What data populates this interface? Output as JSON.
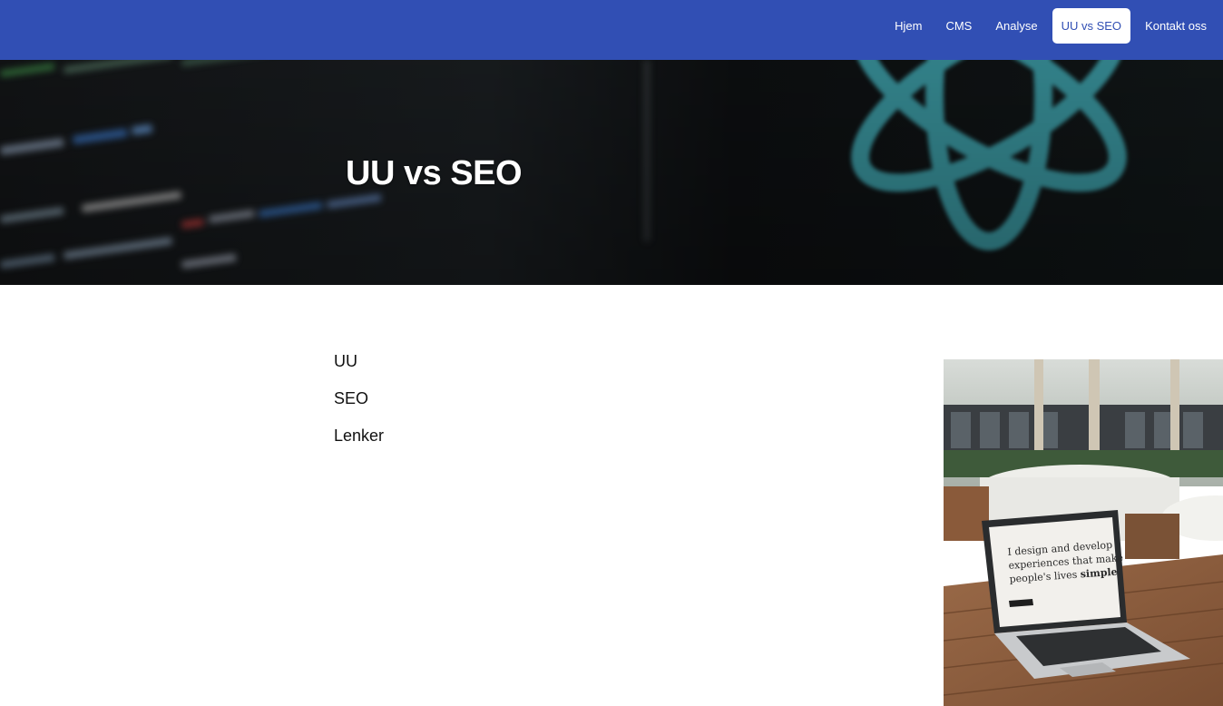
{
  "nav": {
    "items": [
      {
        "label": "Hjem",
        "active": false
      },
      {
        "label": "CMS",
        "active": false
      },
      {
        "label": "Analyse",
        "active": false
      },
      {
        "label": "UU vs SEO",
        "active": true
      },
      {
        "label": "Kontakt oss",
        "active": false
      }
    ]
  },
  "hero": {
    "title": "UU vs SEO"
  },
  "toc": {
    "items": [
      "UU",
      "SEO",
      "Lenker"
    ]
  },
  "photo": {
    "screen_line1": "I design and develop",
    "screen_line2": "experiences that make",
    "screen_line3": "people's lives",
    "screen_emphasis": "simple."
  },
  "colors": {
    "navbar": "#314fb4",
    "hero_dark": "#141618",
    "react_teal": "#3fa6b0"
  }
}
